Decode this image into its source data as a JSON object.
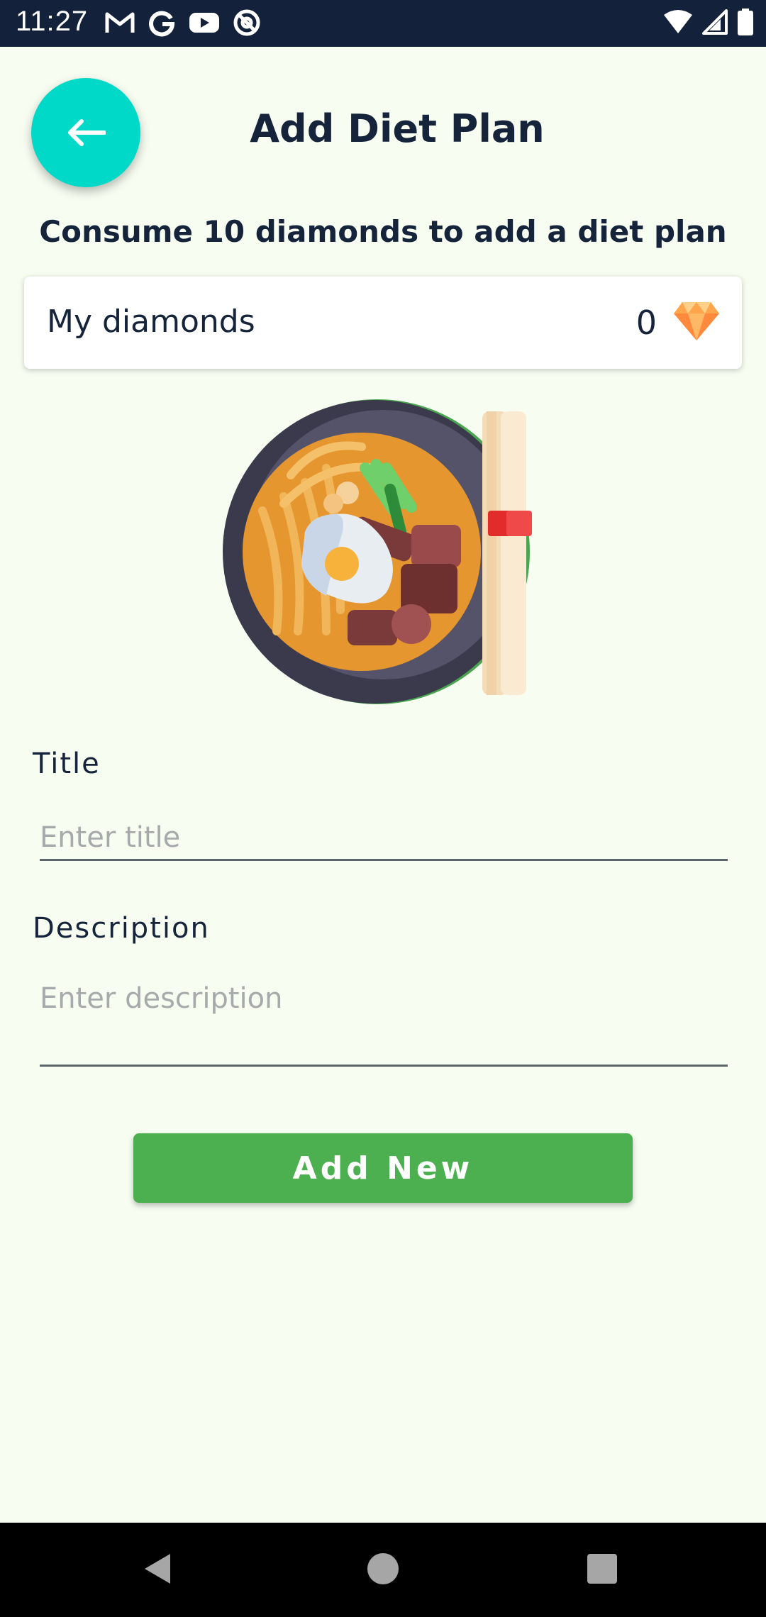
{
  "status_bar": {
    "time": "11:27",
    "left_icons": [
      "gmail-icon",
      "google-icon",
      "youtube-icon",
      "at-sign-icon"
    ],
    "right_icons": [
      "wifi-icon",
      "signal-icon",
      "battery-icon"
    ]
  },
  "header": {
    "back_icon": "arrow-left-icon",
    "title": "Add Diet Plan",
    "accent_color": "#00d9c8"
  },
  "subtitle": "Consume 10 diamonds to add a diet plan",
  "diamonds": {
    "label": "My diamonds",
    "count": "0",
    "icon": "diamond-icon"
  },
  "illustration": "bibimbap-bowl-illustration",
  "form": {
    "title_label": "Title",
    "title_placeholder": "Enter title",
    "title_value": "",
    "description_label": "Description",
    "description_placeholder": "Enter description",
    "description_value": ""
  },
  "add_button": {
    "label": "Add New",
    "color": "#4caf50"
  },
  "nav_bar": {
    "icons": [
      "back-triangle-icon",
      "home-circle-icon",
      "recents-square-icon"
    ]
  }
}
